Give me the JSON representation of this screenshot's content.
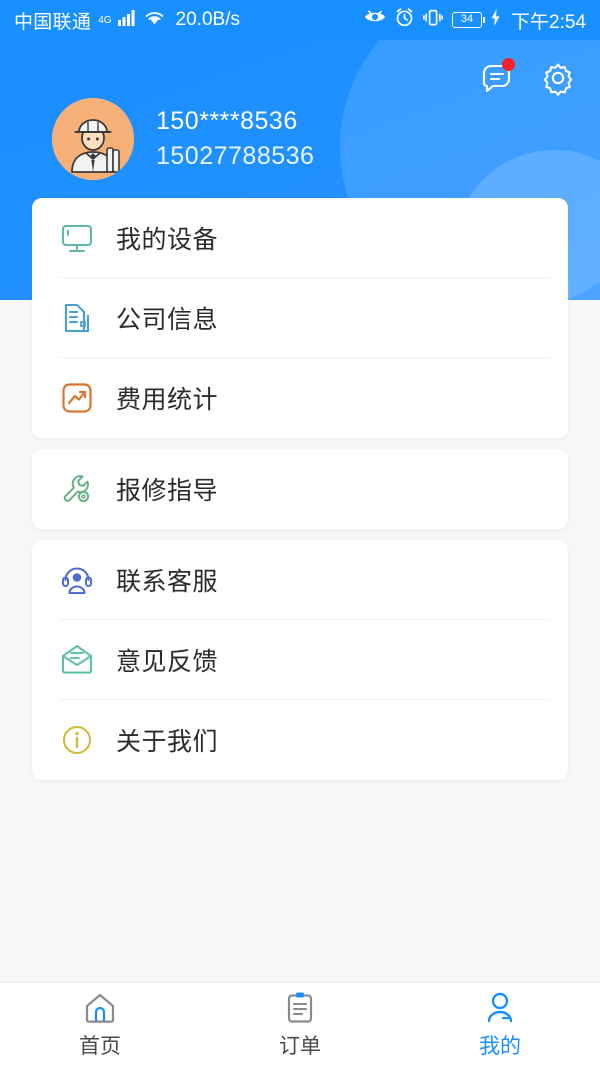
{
  "status_bar": {
    "carrier": "中国联通",
    "network": "4G",
    "speed": "20.0B/s",
    "battery_percent": "34",
    "time": "下午2:54",
    "icons": [
      "eye-comfort-icon",
      "alarm-clock-icon",
      "vibrate-icon",
      "battery-icon",
      "charging-bolt-icon"
    ]
  },
  "header": {
    "actions": [
      {
        "name": "message-icon",
        "has_badge": true
      },
      {
        "name": "settings-gear-icon",
        "has_badge": false
      }
    ],
    "avatar_name": "worker-avatar",
    "phone_masked": "150****8536",
    "phone_full": "15027788536",
    "bg_color": "#1890ff"
  },
  "menu_groups": [
    {
      "items": [
        {
          "label": "我的设备",
          "icon": "monitor-icon",
          "color": "#5fb8ae"
        },
        {
          "label": "公司信息",
          "icon": "building-icon",
          "color": "#4a9fd8"
        },
        {
          "label": "费用统计",
          "icon": "trending-up-chart-icon",
          "color": "#d9762f"
        }
      ]
    },
    {
      "items": [
        {
          "label": "报修指导",
          "icon": "wrench-gear-icon",
          "color": "#6ab08a"
        }
      ]
    },
    {
      "items": [
        {
          "label": "联系客服",
          "icon": "headset-support-icon",
          "color": "#4f6fd0"
        },
        {
          "label": "意见反馈",
          "icon": "envelope-feedback-icon",
          "color": "#5cc2a8"
        },
        {
          "label": "关于我们",
          "icon": "info-circle-icon",
          "color": "#d4b83c"
        }
      ]
    }
  ],
  "tabbar": {
    "active_index": 2,
    "tabs": [
      {
        "label": "首页",
        "icon": "home-icon"
      },
      {
        "label": "订单",
        "icon": "clipboard-orders-icon"
      },
      {
        "label": "我的",
        "icon": "user-profile-icon"
      }
    ]
  },
  "colors": {
    "accent": "#1890ff",
    "badge": "#f5222d",
    "avatar_bg": "#f7b178"
  }
}
